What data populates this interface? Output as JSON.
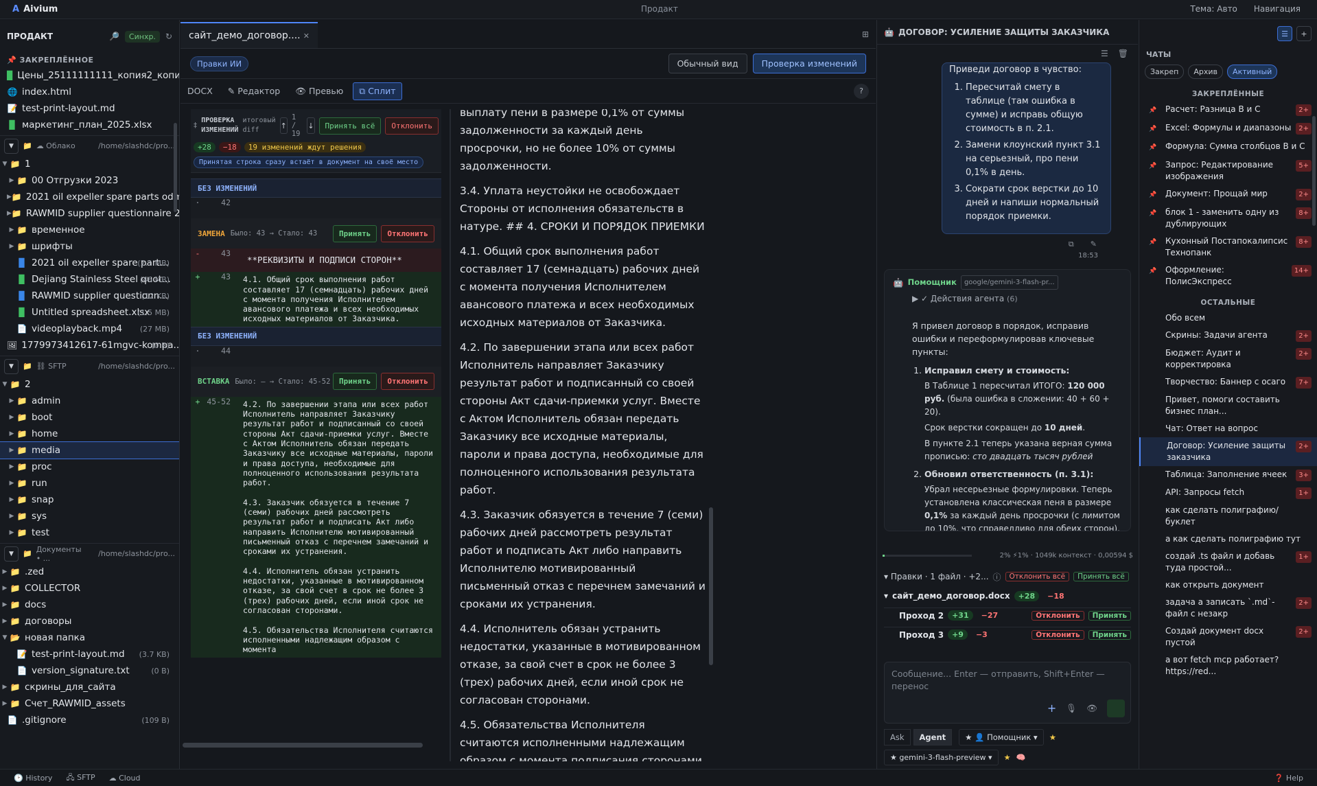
{
  "app": {
    "name": "Aivium",
    "project": "Продакт",
    "theme": "Тема: Авто",
    "nav": "Навигация"
  },
  "sidebar": {
    "title": "ПРОДАКТ",
    "sync_label": "Синхр.",
    "pinned_title": "ЗАКРЕПЛЁННОЕ",
    "pinned": [
      {
        "name": "Цены_25111111111_копия2_копия....",
        "icon": "spreadsheet-icon"
      },
      {
        "name": "index.html",
        "icon": "globe-icon"
      },
      {
        "name": "test-print-layout.md",
        "icon": "markdown-icon"
      },
      {
        "name": "маркетинг_план_2025.xlsx",
        "icon": "spreadsheet-icon"
      }
    ],
    "mounts": [
      {
        "label": "☁ Облако",
        "path": "/home/slashdc/pro...",
        "root": "1",
        "items": [
          {
            "name": "00 Отгрузки 2023",
            "type": "folder",
            "size": ""
          },
          {
            "name": "2021 oil expeller spare parts odm01...",
            "type": "folder",
            "size": ""
          },
          {
            "name": "RAWMID supplier questionnaire 202...",
            "type": "folder",
            "size": ""
          },
          {
            "name": "временное",
            "type": "folder",
            "size": ""
          },
          {
            "name": "шрифты",
            "type": "folder",
            "size": ""
          },
          {
            "name": "2021 oil expeller spare part...",
            "type": "doc",
            "size": "(2.1 MB)"
          },
          {
            "name": "Dejiang Stainless Steel quot...",
            "type": "xls",
            "size": "(46 MB)"
          },
          {
            "name": "RAWMID supplier questionn...",
            "type": "doc",
            "size": "(12 KB)"
          },
          {
            "name": "Untitled spreadsheet.xlsx",
            "type": "xls",
            "size": "(1.5 MB)"
          },
          {
            "name": "videoplayback.mp4",
            "type": "file",
            "size": "(27 MB)"
          }
        ],
        "extra": {
          "name": "1779973412617-61mgvc-kompa...",
          "size": "(0 B)"
        }
      },
      {
        "label": "⛓ SFTP",
        "path": "/home/slashdc/pro...",
        "root": "2",
        "items": [
          "admin",
          "boot",
          "home",
          "media",
          "proc",
          "run",
          "snap",
          "sys",
          "test"
        ]
      },
      {
        "label": "Документы • ...",
        "path": "/home/slashdc/pro...",
        "items": [
          {
            "name": ".zed",
            "type": "folder",
            "size": ""
          },
          {
            "name": "COLLECTOR",
            "type": "folder",
            "size": ""
          },
          {
            "name": "docs",
            "type": "folder",
            "size": ""
          },
          {
            "name": "договоры",
            "type": "folder",
            "size": ""
          },
          {
            "name": "новая папка",
            "type": "folder-open",
            "size": ""
          },
          {
            "name": "test-print-layout.md",
            "type": "md",
            "size": "(3.7 KB)"
          },
          {
            "name": "version_signature.txt",
            "type": "file",
            "size": "(0 B)"
          },
          {
            "name": "скрины_для_сайта",
            "type": "folder",
            "size": ""
          },
          {
            "name": "Счет_RAWMID_assets",
            "type": "folder",
            "size": ""
          },
          {
            "name": ".gitignore",
            "type": "file",
            "size": "(109 B)"
          }
        ]
      }
    ]
  },
  "bottombar": {
    "history": "History",
    "sftp": "SFTP",
    "cloud": "Cloud",
    "help": "Help"
  },
  "editor": {
    "tab_title": "сайт_демо_договор....",
    "ai_edits": "Правки ИИ",
    "normal_view": "Обычный вид",
    "review_changes": "Проверка изменений",
    "format": "DOCX",
    "editor": "Редактор",
    "preview": "Превью",
    "split": "Сплит",
    "help": "?",
    "review": {
      "title": "ПРОВЕРКА ИЗМЕНЕНИЙ",
      "subtitle": "итоговый diff",
      "counter": "1 / 19",
      "accept_all": "Принять всё",
      "reject": "Отклонить",
      "added": "+28",
      "removed": "−18",
      "pending": "19 изменений ждут решения",
      "hint": "Принятая строка сразу встаёт в документ на своё место"
    },
    "blocks": {
      "same1": "БЕЗ ИЗМЕНЕНИЙ",
      "line42": "42",
      "rep": "ЗАМЕНА",
      "rep_sub": "Было: 43 → Стало: 43",
      "accept": "Принять",
      "reject": "Отклонить",
      "del_no": "43",
      "del_text": "**РЕКВИЗИТЫ И ПОДПИСИ СТОРОН**",
      "add_no": "43",
      "add_text": "4.1. Общий срок выполнения работ составляет 17 (семнадцать) рабочих дней с момента получения Исполнителем авансового платежа и всех необходимых исходных материалов от Заказчика.",
      "same2": "БЕЗ ИЗМЕНЕНИЙ",
      "line44": "44",
      "ins": "ВСТАВКА",
      "ins_sub": "Было: — → Стало: 45-52",
      "ins_no": "45-52",
      "ins_text": "4.2. По завершении этапа или всех работ Исполнитель направляет Заказчику результат работ и подписанный со своей стороны Акт сдачи-приемки услуг. Вместе с Актом Исполнитель обязан передать Заказчику все исходные материалы, пароли и права доступа, необходимые для полноценного использования результата работ.\n\n4.3. Заказчик обязуется в течение 7 (семи) рабочих дней рассмотреть результат работ и подписать Акт либо направить Исполнителю мотивированный письменный отказ с перечнем замечаний и сроками их устранения.\n\n4.4. Исполнитель обязан устранить недостатки, указанные в мотивированном отказе, за свой счет в срок не более 3 (трех) рабочих дней, если иной срок не согласован сторонами.\n\n4.5. Обязательства Исполнителя считаются исполненными надлежащим образом с момента"
    },
    "doc": [
      "выплату пени в размере 0,1% от суммы задолженности за каждый день просрочки, но не более 10% от суммы задолженности.",
      "3.4. Уплата неустойки не освобождает Стороны от исполнения обязательств в натуре. ## 4. СРОКИ И ПОРЯДОК ПРИЕМКИ",
      "4.1. Общий срок выполнения работ составляет 17 (семнадцать) рабочих дней с момента получения Исполнителем авансового платежа и всех необходимых исходных материалов от Заказчика.",
      "4.2. По завершении этапа или всех работ Исполнитель направляет Заказчику результат работ и подписанный со своей стороны Акт сдачи-приемки услуг. Вместе с Актом Исполнитель обязан передать Заказчику все исходные материалы, пароли и права доступа, необходимые для полноценного использования результата работ.",
      "4.3. Заказчик обязуется в течение 7 (семи) рабочих дней рассмотреть результат работ и подписать Акт либо направить Исполнителю мотивированный письменный отказ с перечнем замечаний и сроками их устранения.",
      "4.4. Исполнитель обязан устранить недостатки, указанные в мотивированном отказе, за свой счет в срок не более 3 (трех) рабочих дней, если иной срок не согласован сторонами.",
      "4.5. Обязательства Исполнителя считаются исполненными надлежащим образом с момента подписания сторонами"
    ]
  },
  "chat": {
    "title": "ДОГОВОР: УСИЛЕНИЕ ЗАЩИТЫ ЗАКАЗЧИКА",
    "user_intro": "Приведи договор в чувство:",
    "user_items": [
      "Пересчитай смету в таблице (там ошибка в сумме) и исправь общую стоимость в п. 2.1.",
      "Замени клоунский пункт 3.1 на серьезный, про пени 0,1% в день.",
      "Сократи срок верстки до 10 дней и напиши нормальный порядок приемки."
    ],
    "time": "18:53",
    "assistant_name": "Помощник",
    "assistant_model": "google/gemini-3-flash-pr...",
    "agent_actions": "▶ ✓ Действия агента",
    "agent_actions_count": "(6)",
    "answer_intro": "Я привел договор в порядок, исправив ошибки и переформулировав ключевые пункты:",
    "a1_title": "Исправил смету и стоимость:",
    "a1_l1": "В Таблице 1 пересчитал ИТОГО: ",
    "a1_l1b": "120 000 руб.",
    "a1_l1c": " (была ошибка в сложении: 40 + 60 + 20).",
    "a1_l2": "Срок верстки сокращен до ",
    "a1_l2b": "10 дней",
    "a1_l2c": ".",
    "a1_l3": "В пункте 2.1 теперь указана верная сумма прописью: ",
    "a1_l3i": "сто двадцать тысяч рублей",
    "a2_title": "Обновил ответственность (п. 3.1):",
    "a2_l1": "Убрал несерьезные формулировки. Теперь установлена классическая пеня в размере ",
    "a2_l1b": "0,1%",
    "a2_l1c": " за каждый день просрочки (с лимитом до 10%, что справедливо для обеих сторон).",
    "ctx": "2% ⚡1% · 1049k контекст · 0,00594 $",
    "pravki": "Правки · 1 файл · +2...",
    "reject_all": "Отклонить всё",
    "accept_all": "Принять всё",
    "file": "сайт_демо_договор.docx",
    "file_add": "+28",
    "file_del": "−18",
    "passes": [
      {
        "name": "Проход 2",
        "add": "+31",
        "del": "−27"
      },
      {
        "name": "Проход 3",
        "add": "+9",
        "del": "−3"
      }
    ],
    "reject": "Отклонить",
    "accept": "Принять",
    "composer": "Сообщение... Enter — отправить, Shift+Enter — перенос",
    "mode_ask": "Ask",
    "mode_agent": "Agent",
    "helper": "★ 👤 Помощник",
    "model": "★ gemini-3-flash-preview"
  },
  "chats": {
    "title": "ЧАТЫ",
    "filters": [
      "Закреп",
      "Архив",
      "Активный"
    ],
    "pinned_title": "ЗАКРЕПЛЁННЫЕ",
    "pinned": [
      {
        "label": "Расчет: Разница В и С",
        "count": "2+"
      },
      {
        "label": "Excel: Формулы и диапазоны",
        "count": "2+"
      },
      {
        "label": "Формула: Сумма столбцов В и С",
        "count": ""
      },
      {
        "label": "Запрос: Редактирование изображения",
        "count": "5+"
      },
      {
        "label": "Документ: Прощай мир",
        "count": "2+"
      },
      {
        "label": "блок 1 - заменить одну из дублирующих",
        "count": "8+"
      },
      {
        "label": "Кухонный Постапокалипсис Технопанк",
        "count": "8+"
      },
      {
        "label": "Оформление: ПолисЭкспресс",
        "count": "14+"
      }
    ],
    "other_title": "ОСТАЛЬНЫЕ",
    "other": [
      {
        "label": "Обо всем",
        "count": ""
      },
      {
        "label": "Скрины: Задачи агента",
        "count": "2+"
      },
      {
        "label": "Бюджет: Аудит и корректировка",
        "count": "2+"
      },
      {
        "label": "Творчество: Баннер с осаго",
        "count": "7+"
      },
      {
        "label": "Привет, помоги составить бизнес план...",
        "count": ""
      },
      {
        "label": "Чат: Ответ на вопрос",
        "count": ""
      },
      {
        "label": "Договор: Усиление защиты заказчика",
        "count": "2+"
      },
      {
        "label": "Таблица: Заполнение ячеек",
        "count": "3+"
      },
      {
        "label": "API: Запросы fetch",
        "count": "1+"
      },
      {
        "label": "как сделать полиграфию/буклет",
        "count": ""
      },
      {
        "label": "а как сделать полиграфию тут",
        "count": ""
      },
      {
        "label": "создай .ts файл и добавь туда простой...",
        "count": "1+"
      },
      {
        "label": "как открыть документ",
        "count": ""
      },
      {
        "label": "задача а записать `.md`-файл с незакр",
        "count": "2+"
      },
      {
        "label": "Создай документ docx пустой",
        "count": "2+"
      },
      {
        "label": "а вот fetch mcp работает? https://red...",
        "count": ""
      }
    ]
  }
}
